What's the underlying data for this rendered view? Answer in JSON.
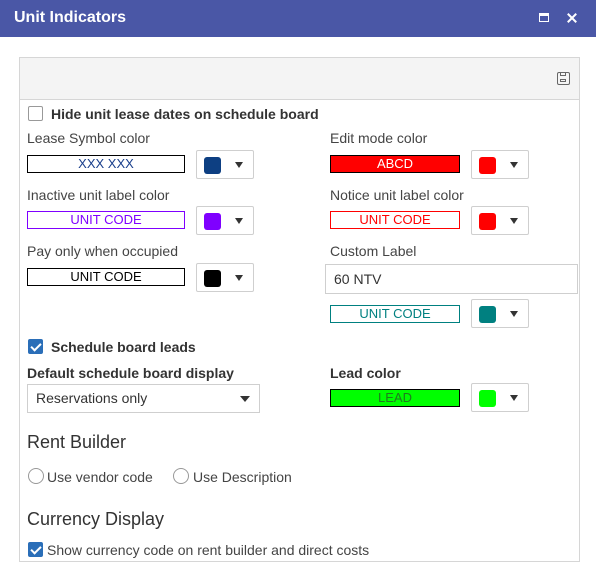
{
  "window": {
    "title": "Unit Indicators"
  },
  "hide_lease_dates": {
    "label": "Hide unit lease dates on schedule board",
    "checked": false
  },
  "lease_symbol": {
    "label": "Lease Symbol color",
    "preview": "XXX XXX",
    "text_color": "#1a3f8c",
    "border_color": "#000000",
    "bg_color": "#ffffff",
    "swatch": "#0d3f82"
  },
  "edit_mode": {
    "label": "Edit mode color",
    "preview": "ABCD",
    "text_color": "#ffffff",
    "border_color": "#000000",
    "bg_color": "#ff0000",
    "swatch": "#ff0000"
  },
  "inactive_unit": {
    "label": "Inactive unit label color",
    "preview": "UNIT CODE",
    "text_color": "#7f00ff",
    "border_color": "#7f00ff",
    "bg_color": "#ffffff",
    "swatch": "#7f00ff"
  },
  "notice_unit": {
    "label": "Notice unit label color",
    "preview": "UNIT CODE",
    "text_color": "#ff0000",
    "border_color": "#ff0000",
    "bg_color": "#ffffff",
    "swatch": "#ff0000"
  },
  "pay_only": {
    "label": "Pay only when occupied",
    "preview": "UNIT CODE",
    "text_color": "#000000",
    "border_color": "#000000",
    "bg_color": "#ffffff",
    "swatch": "#000000"
  },
  "custom_label": {
    "label": "Custom Label",
    "value": "60 NTV",
    "preview": "UNIT CODE",
    "text_color": "#008080",
    "border_color": "#008080",
    "bg_color": "#ffffff",
    "swatch": "#008080"
  },
  "schedule_leads": {
    "label": "Schedule board leads",
    "checked": true
  },
  "default_display": {
    "label": "Default schedule board display",
    "value": "Reservations only"
  },
  "lead_color": {
    "label": "Lead color",
    "preview": "LEAD",
    "text_color": "#1f7a1f",
    "border_color": "#000000",
    "bg_color": "#00ff00",
    "swatch": "#00ff00"
  },
  "rent_builder": {
    "title": "Rent Builder",
    "option_vendor": "Use vendor code",
    "option_description": "Use Description"
  },
  "currency": {
    "title": "Currency Display",
    "show_label": "Show currency code on rent builder and direct costs",
    "checked": true
  }
}
